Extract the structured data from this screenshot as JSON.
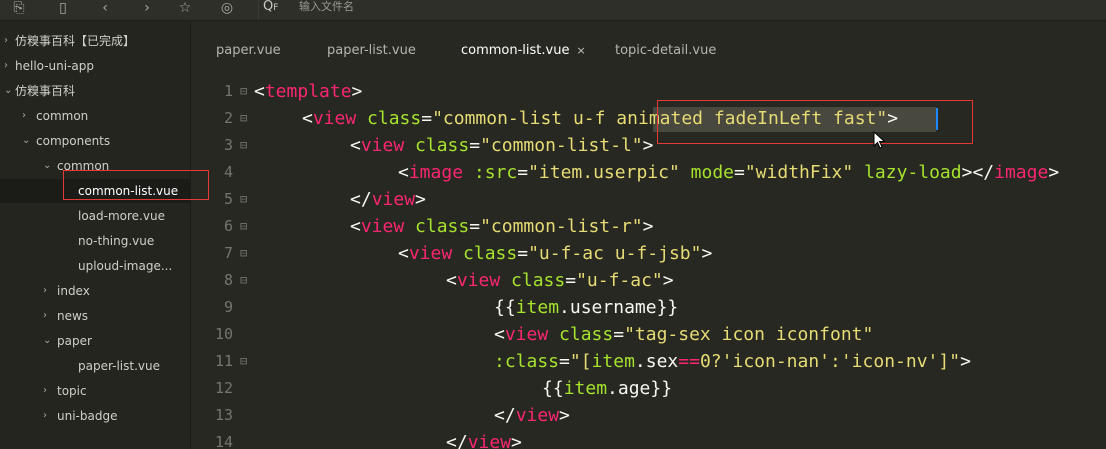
{
  "toolbar": {
    "icons": [
      "new-file-icon",
      "save-icon",
      "back-icon",
      "forward-icon",
      "star-icon",
      "run-icon"
    ],
    "search_prefix": "Q",
    "search_placeholder": "输入文件名"
  },
  "sidebar": {
    "items": [
      {
        "label": "仿糗事百科【已完成】",
        "chevron": "›",
        "depth": 0
      },
      {
        "label": "hello-uni-app",
        "chevron": "›",
        "depth": 0
      },
      {
        "label": "仿糗事百科",
        "chevron": "⌄",
        "depth": 0
      },
      {
        "label": "common",
        "chevron": "›",
        "depth": 1
      },
      {
        "label": "components",
        "chevron": "⌄",
        "depth": 1
      },
      {
        "label": "common",
        "chevron": "⌄",
        "depth": 2
      },
      {
        "label": "common-list.vue",
        "chevron": "",
        "depth": 3,
        "selected": true
      },
      {
        "label": "load-more.vue",
        "chevron": "",
        "depth": 3
      },
      {
        "label": "no-thing.vue",
        "chevron": "",
        "depth": 3
      },
      {
        "label": "uploud-image...",
        "chevron": "",
        "depth": 3
      },
      {
        "label": "index",
        "chevron": "›",
        "depth": 2
      },
      {
        "label": "news",
        "chevron": "›",
        "depth": 2
      },
      {
        "label": "paper",
        "chevron": "⌄",
        "depth": 2
      },
      {
        "label": "paper-list.vue",
        "chevron": "",
        "depth": 3
      },
      {
        "label": "topic",
        "chevron": "›",
        "depth": 2
      },
      {
        "label": "uni-badge",
        "chevron": "›",
        "depth": 2
      }
    ]
  },
  "tabs": [
    {
      "label": "paper.vue",
      "active": false
    },
    {
      "label": "paper-list.vue",
      "active": false
    },
    {
      "label": "common-list.vue",
      "active": true,
      "close": "×"
    },
    {
      "label": "topic-detail.vue",
      "active": false
    }
  ],
  "editor": {
    "lines": [
      {
        "num": "1",
        "fold": "⊟",
        "indent": 0,
        "tokens": [
          [
            "p",
            "<"
          ],
          [
            "t",
            "template"
          ],
          [
            "p",
            ">"
          ]
        ]
      },
      {
        "num": "2",
        "fold": "⊟",
        "indent": 1,
        "tokens": [
          [
            "p",
            "<"
          ],
          [
            "t",
            "view"
          ],
          [
            "x",
            " "
          ],
          [
            "a",
            "class"
          ],
          [
            "p",
            "="
          ],
          [
            "s",
            "\"common-list u-f animated fadeInLeft fast\""
          ],
          [
            "p",
            ">"
          ]
        ]
      },
      {
        "num": "3",
        "fold": "⊟",
        "indent": 2,
        "tokens": [
          [
            "p",
            "<"
          ],
          [
            "t",
            "view"
          ],
          [
            "x",
            " "
          ],
          [
            "a",
            "class"
          ],
          [
            "p",
            "="
          ],
          [
            "s",
            "\"common-list-l\""
          ],
          [
            "p",
            ">"
          ]
        ]
      },
      {
        "num": "4",
        "fold": "",
        "indent": 3,
        "tokens": [
          [
            "p",
            "<"
          ],
          [
            "t",
            "image"
          ],
          [
            "x",
            " "
          ],
          [
            "a",
            ":src"
          ],
          [
            "p",
            "="
          ],
          [
            "s",
            "\"item.userpic\""
          ],
          [
            "x",
            " "
          ],
          [
            "a",
            "mode"
          ],
          [
            "p",
            "="
          ],
          [
            "s",
            "\"widthFix\""
          ],
          [
            "x",
            " "
          ],
          [
            "a",
            "lazy-load"
          ],
          [
            "p",
            "></"
          ],
          [
            "t",
            "image"
          ],
          [
            "p",
            ">"
          ]
        ]
      },
      {
        "num": "5",
        "fold": "⊟",
        "indent": 2,
        "tokens": [
          [
            "p",
            "</"
          ],
          [
            "t",
            "view"
          ],
          [
            "p",
            ">"
          ]
        ]
      },
      {
        "num": "6",
        "fold": "⊟",
        "indent": 2,
        "tokens": [
          [
            "p",
            "<"
          ],
          [
            "t",
            "view"
          ],
          [
            "x",
            " "
          ],
          [
            "a",
            "class"
          ],
          [
            "p",
            "="
          ],
          [
            "s",
            "\"common-list-r\""
          ],
          [
            "p",
            ">"
          ]
        ]
      },
      {
        "num": "7",
        "fold": "⊟",
        "indent": 3,
        "tokens": [
          [
            "p",
            "<"
          ],
          [
            "t",
            "view"
          ],
          [
            "x",
            " "
          ],
          [
            "a",
            "class"
          ],
          [
            "p",
            "="
          ],
          [
            "s",
            "\"u-f-ac u-f-jsb\""
          ],
          [
            "p",
            ">"
          ]
        ]
      },
      {
        "num": "8",
        "fold": "⊟",
        "indent": 4,
        "tokens": [
          [
            "p",
            "<"
          ],
          [
            "t",
            "view"
          ],
          [
            "x",
            " "
          ],
          [
            "a",
            "class"
          ],
          [
            "p",
            "="
          ],
          [
            "s",
            "\"u-f-ac\""
          ],
          [
            "p",
            ">"
          ]
        ]
      },
      {
        "num": "9",
        "fold": "",
        "indent": 5,
        "tokens": [
          [
            "x",
            "{{"
          ],
          [
            "a",
            "item"
          ],
          [
            "x",
            ".username}}"
          ]
        ]
      },
      {
        "num": "10",
        "fold": "",
        "indent": 5,
        "tokens": [
          [
            "p",
            "<"
          ],
          [
            "t",
            "view"
          ],
          [
            "x",
            " "
          ],
          [
            "a",
            "class"
          ],
          [
            "p",
            "="
          ],
          [
            "s",
            "\"tag-sex icon iconfont\""
          ]
        ]
      },
      {
        "num": "11",
        "fold": "⊟",
        "indent": 5,
        "tokens": [
          [
            "a",
            ":class"
          ],
          [
            "p",
            "="
          ],
          [
            "s",
            "\"["
          ],
          [
            "a",
            "item"
          ],
          [
            "x",
            ".sex"
          ],
          [
            "t",
            "=="
          ],
          [
            "s",
            "0?'icon-nan':'icon-nv']\""
          ],
          [
            "p",
            ">"
          ]
        ]
      },
      {
        "num": "12",
        "fold": "",
        "indent": 6,
        "tokens": [
          [
            "x",
            "{{"
          ],
          [
            "a",
            "item"
          ],
          [
            "x",
            ".age}}"
          ]
        ]
      },
      {
        "num": "13",
        "fold": "",
        "indent": 5,
        "tokens": [
          [
            "p",
            "</"
          ],
          [
            "t",
            "view"
          ],
          [
            "p",
            ">"
          ]
        ]
      },
      {
        "num": "14",
        "fold": "",
        "indent": 4,
        "tokens": [
          [
            "p",
            "</"
          ],
          [
            "t",
            "view"
          ],
          [
            "p",
            ">"
          ]
        ]
      }
    ]
  },
  "colors": {
    "editor_bg": "#272822",
    "sidebar_bg": "#24251f",
    "tag": "#f92672",
    "attr": "#a6e22e",
    "string": "#e6db74",
    "highlight_box": "#e53935"
  }
}
